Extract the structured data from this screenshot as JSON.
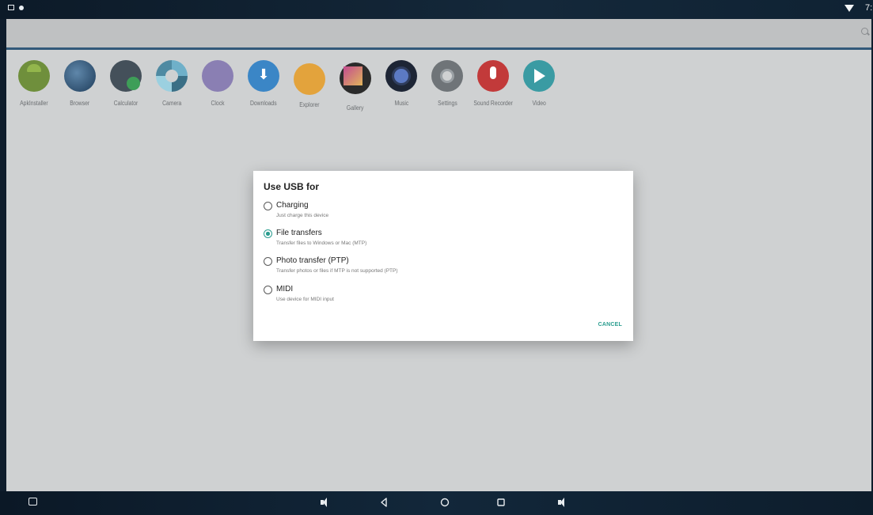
{
  "status_bar": {
    "time": "7:"
  },
  "apps": [
    {
      "label": "ApkInstaller",
      "icon": "apk-installer-icon"
    },
    {
      "label": "Browser",
      "icon": "browser-icon"
    },
    {
      "label": "Calculator",
      "icon": "calculator-icon"
    },
    {
      "label": "Camera",
      "icon": "camera-icon"
    },
    {
      "label": "Clock",
      "icon": "clock-icon"
    },
    {
      "label": "Downloads",
      "icon": "downloads-icon"
    },
    {
      "label": "Explorer",
      "icon": "explorer-icon"
    },
    {
      "label": "Gallery",
      "icon": "gallery-icon"
    },
    {
      "label": "Music",
      "icon": "music-icon"
    },
    {
      "label": "Settings",
      "icon": "settings-icon"
    },
    {
      "label": "Sound Recorder",
      "icon": "sound-recorder-icon"
    },
    {
      "label": "Video",
      "icon": "video-icon"
    }
  ],
  "dialog": {
    "title": "Use USB for",
    "options": [
      {
        "label": "Charging",
        "sub": "Just charge this device",
        "checked": false
      },
      {
        "label": "File transfers",
        "sub": "Transfer files to Windows or Mac (MTP)",
        "checked": true
      },
      {
        "label": "Photo transfer (PTP)",
        "sub": "Transfer photos or files if MTP is not supported (PTP)",
        "checked": false
      },
      {
        "label": "MIDI",
        "sub": "Use device for MIDI input",
        "checked": false
      }
    ],
    "cancel_label": "CANCEL"
  },
  "colors": {
    "accent": "#2a9d8f",
    "status_bar": "#0f1d2c",
    "desktop": "#cfd1d2"
  }
}
